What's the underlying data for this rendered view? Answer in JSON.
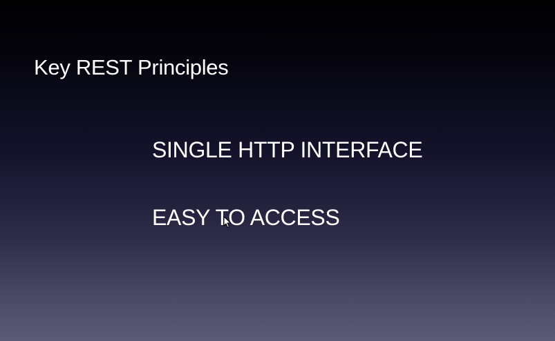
{
  "slide": {
    "title": "Key REST Principles",
    "bullets": [
      {
        "text": "SINGLE HTTP INTERFACE"
      },
      {
        "text": "EASY TO ACCESS"
      }
    ]
  },
  "cursor": {
    "icon": "mouse-pointer-icon"
  },
  "colors": {
    "background_top": "#000000",
    "background_bottom": "#5c5a74",
    "text": "#ffffff"
  }
}
